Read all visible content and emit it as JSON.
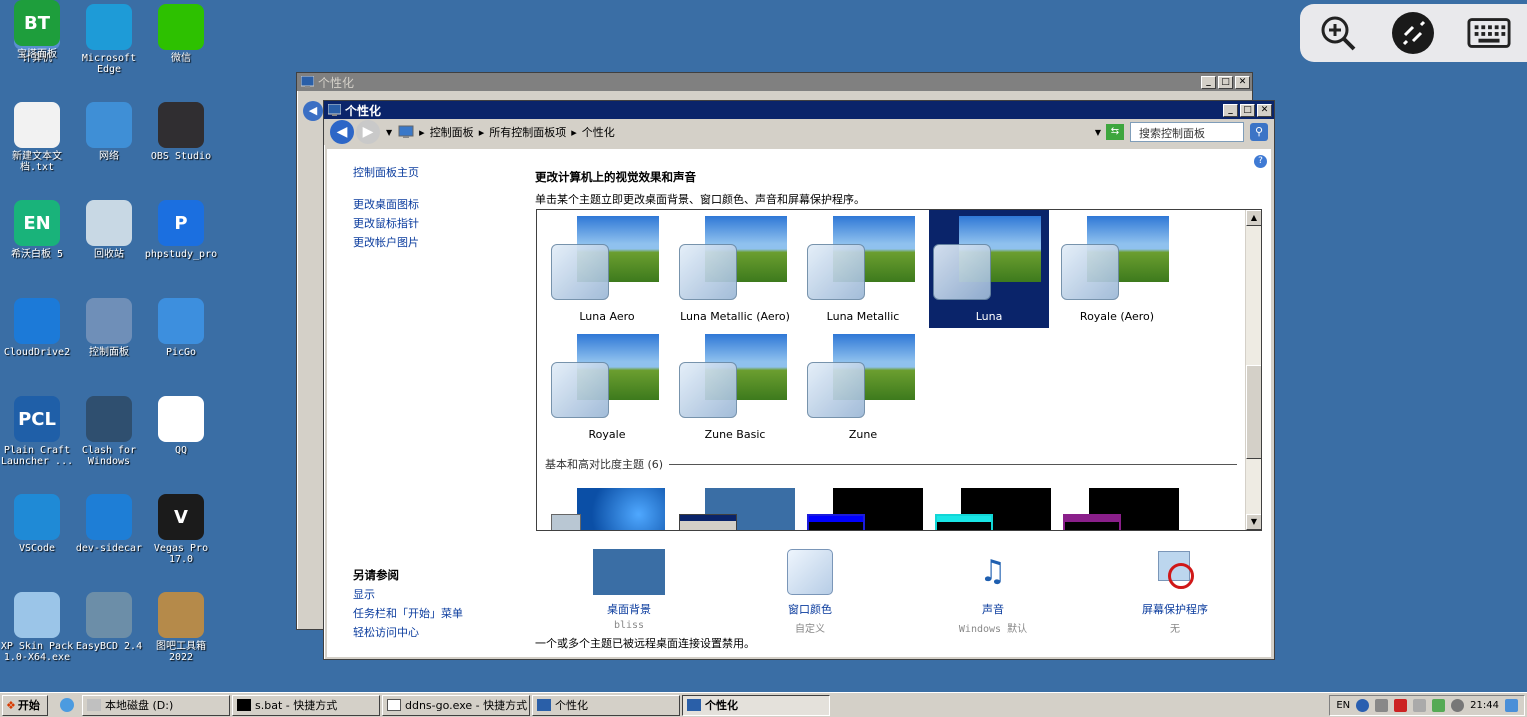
{
  "desktop_icons": [
    {
      "label": "计算机",
      "icon": "computer-icon",
      "color": "#5a8fd0"
    },
    {
      "label": "Microsoft\nEdge",
      "icon": "edge-icon",
      "color": "#1e9bd7"
    },
    {
      "label": "微信",
      "icon": "wechat-icon",
      "color": "#2dc100"
    },
    {
      "label": "新建文本文\n档.txt",
      "icon": "text-file-icon",
      "color": "#f2f2f2"
    },
    {
      "label": "网络",
      "icon": "network-icon",
      "color": "#3f8fd6"
    },
    {
      "label": "OBS Studio",
      "icon": "obs-icon",
      "color": "#302e31"
    },
    {
      "label": "希沃白板 5",
      "icon": "easinote-icon",
      "color": "#19b37a",
      "glyph": "EN"
    },
    {
      "label": "回收站",
      "icon": "recycle-bin-icon",
      "color": "#c8d8e4"
    },
    {
      "label": "phpstudy_pro",
      "icon": "phpstudy-icon",
      "color": "#1b6fe0",
      "glyph": "P"
    },
    {
      "label": "CloudDrive2",
      "icon": "clouddrive-icon",
      "color": "#1c7ad8"
    },
    {
      "label": "控制面板",
      "icon": "control-panel-icon",
      "color": "#6f8fb8"
    },
    {
      "label": "PicGo",
      "icon": "picgo-icon",
      "color": "#3d8fde"
    },
    {
      "label": "Plain Craft\nLauncher ...",
      "icon": "pcl-icon",
      "color": "#1f5fa8",
      "glyph": "PCL"
    },
    {
      "label": "Clash for\nWindows",
      "icon": "clash-icon",
      "color": "#2f4f6f"
    },
    {
      "label": "QQ",
      "icon": "qq-icon",
      "color": "#ffffff"
    },
    {
      "label": "VSCode",
      "icon": "vscode-icon",
      "color": "#1f8ad6"
    },
    {
      "label": "dev-sidecar",
      "icon": "dev-sidecar-icon",
      "color": "#1e7ed6"
    },
    {
      "label": "Vegas Pro\n17.0",
      "icon": "vegas-icon",
      "color": "#1b1b1b",
      "glyph": "V"
    },
    {
      "label": "XP Skin Pack\n1.0-X64.exe",
      "icon": "xp-skin-pack-icon",
      "color": "#9bc5e8"
    },
    {
      "label": "EasyBCD 2.4",
      "icon": "easybcd-icon",
      "color": "#6c8ea8"
    },
    {
      "label": "图吧工具箱\n2022",
      "icon": "tuba-toolbox-icon",
      "color": "#b58a4a"
    },
    {
      "label": "宝塔面板",
      "icon": "baota-icon",
      "color": "#1e9e3c",
      "glyph": "BT"
    }
  ],
  "remote_toolbar": {
    "zoom_icon": "zoom-in-icon",
    "connect_icon": "remote-connect-icon",
    "keyboard_icon": "keyboard-icon"
  },
  "back_window": {
    "title": "个性化"
  },
  "window": {
    "title": "个性化",
    "address": {
      "crumbs": [
        "控制面板",
        "所有控制面板项",
        "个性化"
      ],
      "search_placeholder": "搜索控制面板"
    },
    "sidebar": {
      "home": "控制面板主页",
      "links": [
        "更改桌面图标",
        "更改鼠标指针",
        "更改帐户图片"
      ],
      "see_also_title": "另请参阅",
      "see_also": [
        "显示",
        "任务栏和「开始」菜单",
        "轻松访问中心"
      ]
    },
    "main": {
      "heading": "更改计算机上的视觉效果和声音",
      "subheading": "单击某个主题立即更改桌面背景、窗口颜色、声音和屏幕保护程序。",
      "themes": [
        "Luna Aero",
        "Luna Metallic (Aero)",
        "Luna Metallic",
        "Luna",
        "Royale (Aero)",
        "Royale",
        "Zune Basic",
        "Zune"
      ],
      "selected_theme": "Luna",
      "basic_group_label": "基本和高对比度主题 (6)",
      "bottom": [
        {
          "label": "桌面背景",
          "sub": "bliss",
          "icon": "desktop-background-icon"
        },
        {
          "label": "窗口颜色",
          "sub": "自定义",
          "icon": "window-color-icon"
        },
        {
          "label": "声音",
          "sub": "Windows 默认",
          "icon": "sounds-icon"
        },
        {
          "label": "屏幕保护程序",
          "sub": "无",
          "icon": "screensaver-icon"
        }
      ],
      "footnote": "一个或多个主题已被远程桌面连接设置禁用。"
    }
  },
  "taskbar": {
    "start": "开始",
    "tasks": [
      {
        "label": "本地磁盘 (D:)",
        "icon": "drive-icon"
      },
      {
        "label": "s.bat - 快捷方式",
        "icon": "cmd-icon"
      },
      {
        "label": "ddns-go.exe - 快捷方式",
        "icon": "app-icon"
      },
      {
        "label": "个性化",
        "icon": "personalize-icon"
      },
      {
        "label": "个性化",
        "icon": "personalize-icon",
        "active": true
      }
    ],
    "tray": {
      "lang": "EN",
      "time": "21:44"
    }
  }
}
